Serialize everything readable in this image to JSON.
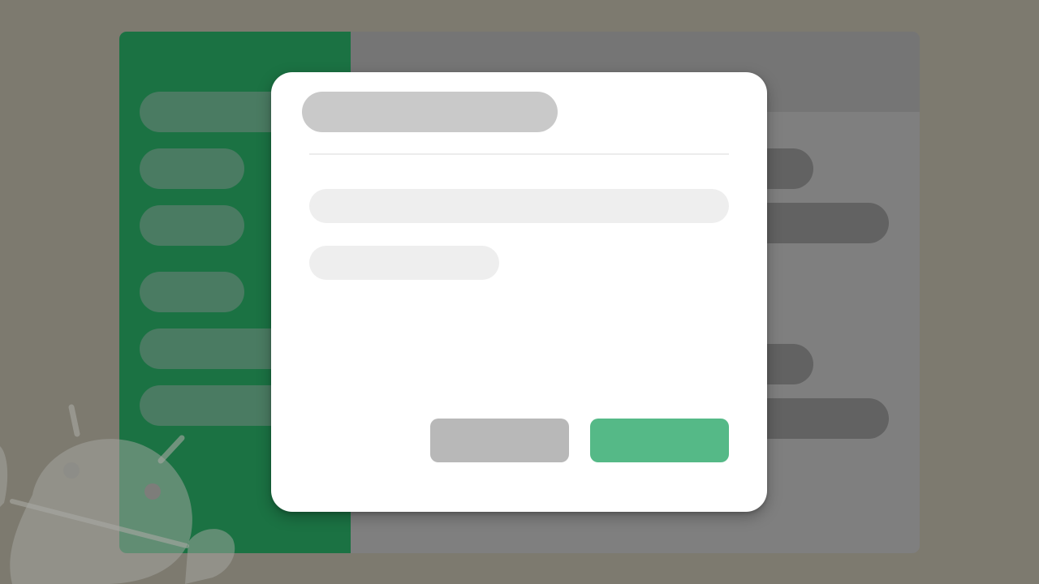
{
  "colors": {
    "backdrop": "#7d7a6f",
    "sidebar": "#1b7243",
    "sidebar_placeholder": "#4a7b62",
    "content_background": "#7f7f7f",
    "content_header": "#757575",
    "content_placeholder": "#626262",
    "dialog_background": "#ffffff",
    "dialog_title_placeholder": "#c9c9c9",
    "dialog_text_placeholder": "#eeeeee",
    "secondary_button": "#b8b8b8",
    "primary_button": "#55b987",
    "mascot": "#a8a8a3"
  },
  "background_app": {
    "sidebar": {
      "items": [
        "",
        "",
        "",
        "",
        "",
        ""
      ]
    },
    "content": {
      "header_title": "",
      "rows": [
        "",
        "",
        "",
        ""
      ]
    },
    "decoration": {
      "icon": "android-mascot-icon"
    }
  },
  "dialog": {
    "title": "",
    "body_lines": [
      "",
      ""
    ],
    "buttons": {
      "cancel_label": "",
      "confirm_label": ""
    }
  }
}
